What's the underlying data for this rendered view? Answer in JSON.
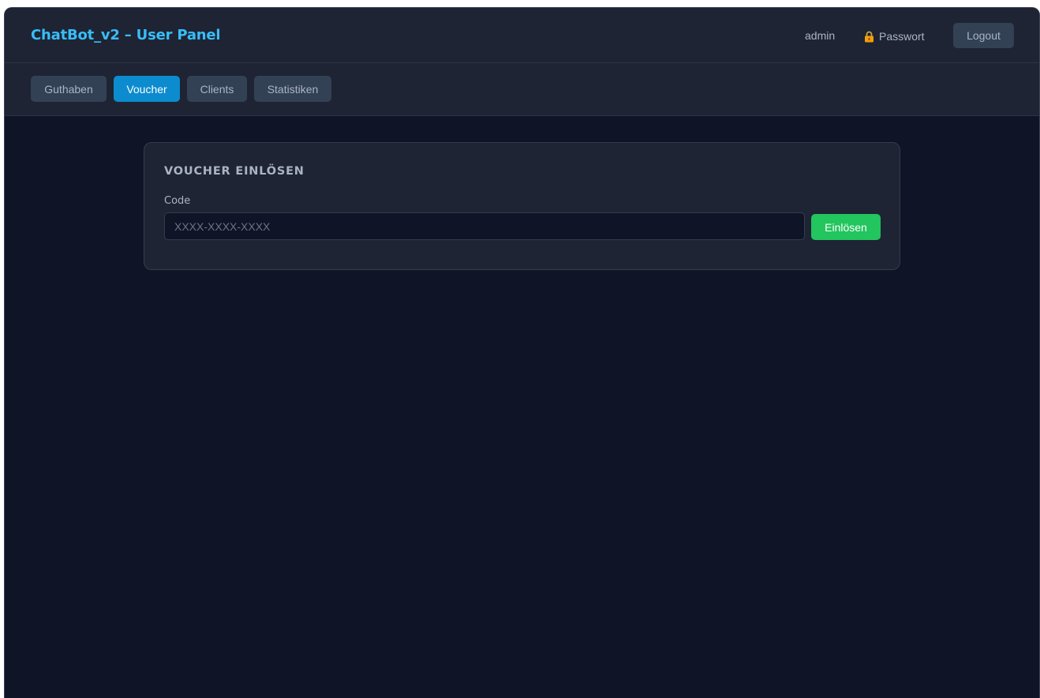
{
  "app": {
    "title": "ChatBot_v2 – User Panel"
  },
  "header": {
    "username": "admin",
    "password_label": "Passwort",
    "password_icon": "lock-icon",
    "logout_label": "Logout"
  },
  "tabs": [
    {
      "label": "Guthaben",
      "active": false
    },
    {
      "label": "Voucher",
      "active": true
    },
    {
      "label": "Clients",
      "active": false
    },
    {
      "label": "Statistiken",
      "active": false
    }
  ],
  "voucher": {
    "title": "VOUCHER EINLÖSEN",
    "code_label": "Code",
    "code_value": "",
    "code_placeholder": "XXXX-XXXX-XXXX",
    "redeem_label": "Einlösen"
  },
  "colors": {
    "accent": "#38bdf8",
    "active_tab": "#0c8bcf",
    "success": "#22c55e",
    "background": "#0f1426",
    "panel": "#1e2433"
  }
}
